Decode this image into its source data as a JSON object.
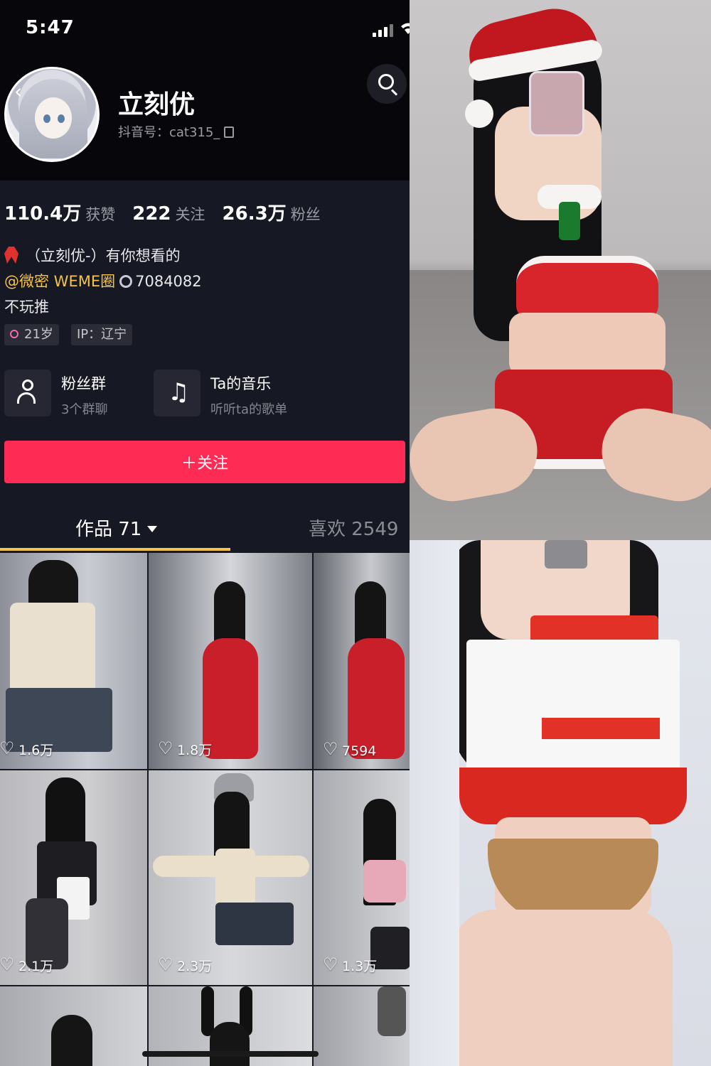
{
  "status_bar": {
    "time": "5:47"
  },
  "profile": {
    "nickname": "立刻优",
    "douyin_id": "抖音号：cat315_",
    "stats": [
      {
        "value": "110.4万",
        "label": "获赞"
      },
      {
        "value": "222",
        "label": "关注"
      },
      {
        "value": "26.3万",
        "label": "粉丝"
      }
    ],
    "bio": {
      "line1": "（立刻优-）有你想看的",
      "line2_link": "@微密 WEME圈",
      "line2_rest": "7084082",
      "line3": "不玩推"
    },
    "tags": {
      "age": "21岁",
      "ip": "IP：辽宁"
    }
  },
  "features": [
    {
      "title": "粉丝群",
      "subtitle": "3个群聊",
      "icon": "user-group-icon"
    },
    {
      "title": "Ta的音乐",
      "subtitle": "听听ta的歌单",
      "icon": "music-note-icon"
    }
  ],
  "follow_button": "＋关注",
  "tabs": {
    "works": "作品 71",
    "likes": "喜欢 2549"
  },
  "grid": [
    {
      "likes": "1.6万"
    },
    {
      "likes": "1.8万"
    },
    {
      "likes": "7594"
    },
    {
      "likes": "2.1万"
    },
    {
      "likes": "2.3万"
    },
    {
      "likes": "1.3万"
    },
    {
      "likes": ""
    },
    {
      "likes": ""
    },
    {
      "likes": ""
    }
  ],
  "colors": {
    "accent": "#fe2c55",
    "link": "#f5c24b",
    "background": "#161823"
  }
}
